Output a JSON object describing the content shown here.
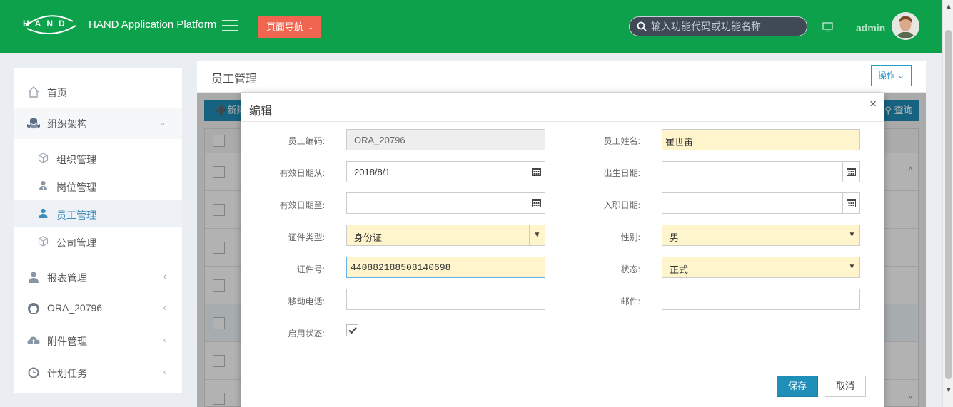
{
  "header": {
    "logo_text": "HAND",
    "app_title": "HAND Application Platform",
    "nav_button": "页面导航",
    "search_placeholder": "输入功能代码或功能名称",
    "user_name": "admin",
    "colors": {
      "bar": "#0ea14b",
      "nav_button": "#f0654f"
    }
  },
  "sidebar": {
    "items": [
      {
        "label": "首页",
        "icon": "home-icon"
      },
      {
        "label": "组织架构",
        "icon": "cubes-icon",
        "expanded": true
      },
      {
        "label": "报表管理",
        "icon": "user-icon"
      },
      {
        "label": "ORA_20796",
        "icon": "github-icon"
      },
      {
        "label": "附件管理",
        "icon": "cloud-upload-icon"
      },
      {
        "label": "计划任务",
        "icon": "clock-icon"
      }
    ],
    "sub_items": [
      {
        "label": "组织管理",
        "icon": "cube-icon"
      },
      {
        "label": "岗位管理",
        "icon": "user-tie-icon"
      },
      {
        "label": "员工管理",
        "icon": "user-icon",
        "active": true
      },
      {
        "label": "公司管理",
        "icon": "cube-icon"
      }
    ]
  },
  "content": {
    "title": "员工管理",
    "ops_button": "操作",
    "new_button": "新建",
    "query_button": "查询"
  },
  "modal": {
    "title": "编辑",
    "close": "×",
    "fields": {
      "employee_code": {
        "label": "员工编码:",
        "value": "ORA_20796"
      },
      "employee_name": {
        "label": "员工姓名:",
        "value": "崔世宙"
      },
      "effective_from": {
        "label": "有效日期从:",
        "value": "2018/8/1"
      },
      "birth_date": {
        "label": "出生日期:",
        "value": ""
      },
      "effective_to": {
        "label": "有效日期至:",
        "value": ""
      },
      "hire_date": {
        "label": "入职日期:",
        "value": ""
      },
      "id_type": {
        "label": "证件类型:",
        "value": "身份证"
      },
      "gender": {
        "label": "性别:",
        "value": "男"
      },
      "id_number": {
        "label": "证件号:",
        "value": "440882188508140698"
      },
      "status": {
        "label": "状态:",
        "value": "正式"
      },
      "mobile": {
        "label": "移动电话:",
        "value": ""
      },
      "email": {
        "label": "邮件:",
        "value": ""
      },
      "enabled": {
        "label": "启用状态:",
        "checked": true
      }
    },
    "save_button": "保存",
    "cancel_button": "取消"
  }
}
